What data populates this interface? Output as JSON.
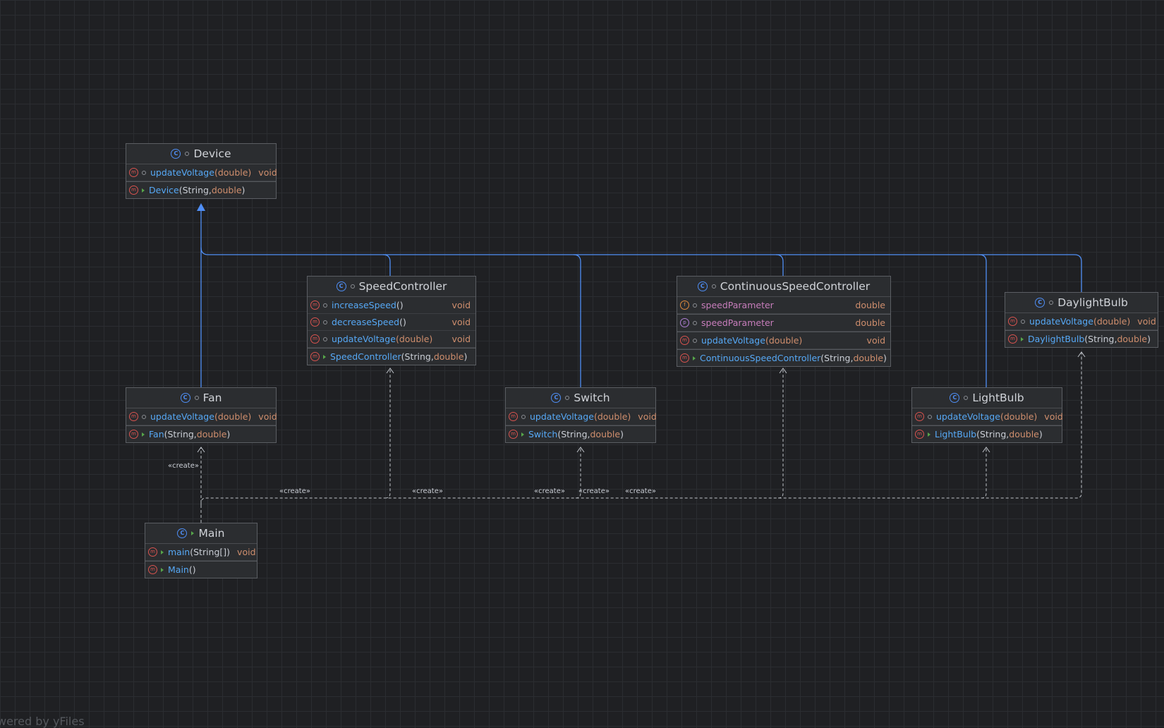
{
  "nodes": {
    "device": {
      "title": "Device",
      "members": [
        {
          "name": "updateVoltage",
          "params": "(double)",
          "ret": "void"
        },
        {
          "name": "Device",
          "params_a": "(String, ",
          "params_b": "double",
          "params_c": ")"
        }
      ]
    },
    "speed_controller": {
      "title": "SpeedController",
      "members": [
        {
          "name": "increaseSpeed",
          "params": "()",
          "ret": "void"
        },
        {
          "name": "decreaseSpeed",
          "params": "()",
          "ret": "void"
        },
        {
          "name": "updateVoltage",
          "params": "(double)",
          "ret": "void"
        },
        {
          "name": "SpeedController",
          "params_a": "(String, ",
          "params_b": "double",
          "params_c": ")"
        }
      ]
    },
    "continuous_speed_controller": {
      "title": "ContinuousSpeedController",
      "members": [
        {
          "name": "speedParameter",
          "ret": "double"
        },
        {
          "name": "speedParameter",
          "ret": "double"
        },
        {
          "name": "updateVoltage",
          "params": "(double)",
          "ret": "void"
        },
        {
          "name": "ContinuousSpeedController",
          "params_a": "(String, ",
          "params_b": "double",
          "params_c": ")"
        }
      ]
    },
    "daylight_bulb": {
      "title": "DaylightBulb",
      "members": [
        {
          "name": "updateVoltage",
          "params": "(double)",
          "ret": "void"
        },
        {
          "name": "DaylightBulb",
          "params_a": "(String, ",
          "params_b": "double",
          "params_c": ")"
        }
      ]
    },
    "fan": {
      "title": "Fan",
      "members": [
        {
          "name": "updateVoltage",
          "params": "(double)",
          "ret": "void"
        },
        {
          "name": "Fan",
          "params_a": "(String, ",
          "params_b": "double",
          "params_c": ")"
        }
      ]
    },
    "switch": {
      "title": "Switch",
      "members": [
        {
          "name": "updateVoltage",
          "params": "(double)",
          "ret": "void"
        },
        {
          "name": "Switch",
          "params_a": "(String, ",
          "params_b": "double",
          "params_c": ")"
        }
      ]
    },
    "light_bulb": {
      "title": "LightBulb",
      "members": [
        {
          "name": "updateVoltage",
          "params": "(double)",
          "ret": "void"
        },
        {
          "name": "LightBulb",
          "params_a": "(String, ",
          "params_b": "double",
          "params_c": ")"
        }
      ]
    },
    "main": {
      "title": "Main",
      "members": [
        {
          "name": "main",
          "params": "(String[])",
          "ret": "void"
        },
        {
          "name": "Main",
          "params": "()"
        }
      ]
    }
  },
  "edge_labels": {
    "create": "«create»"
  },
  "icons": {
    "class": "class-icon",
    "method": "method-icon",
    "field": "field-icon",
    "property": "property-icon"
  },
  "watermark": "wered by yFiles",
  "colors": {
    "background": "#1f2023",
    "inheritance_edge": "#4f8ef5",
    "dependency_edge": "#c9cdd4",
    "method_name": "#56a8f5",
    "field_name": "#c77dbb",
    "type": "#cf8e6d"
  }
}
